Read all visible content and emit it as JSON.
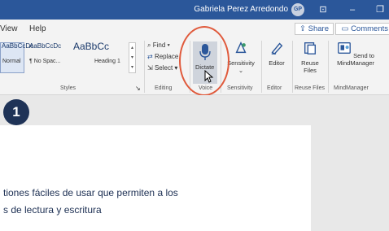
{
  "titlebar": {
    "user_name": "Gabriela Perez Arredondo",
    "user_initials": "GP",
    "controls": {
      "ribbon_display": "⊡",
      "minimize": "–",
      "restore": "❐"
    }
  },
  "menubar": {
    "tabs": [
      "View",
      "Help"
    ],
    "share_label": "Share",
    "comments_label": "Comments"
  },
  "ribbon": {
    "styles_group": {
      "label": "Styles",
      "items": [
        {
          "sample": "AaBbCcDc",
          "name": "Normal"
        },
        {
          "sample": "AaBbCcDc",
          "name": "¶ No Spac..."
        },
        {
          "sample": "AaBbCc",
          "name": "Heading 1"
        }
      ]
    },
    "editing_group": {
      "label": "Editing",
      "find": "Find",
      "replace": "Replace",
      "select": "Select"
    },
    "voice_group": {
      "label": "Voice",
      "dictate": "Dictate"
    },
    "sensitivity_group": {
      "label": "Sensitivity",
      "button": "Sensitivity"
    },
    "editor_group": {
      "label": "Editor",
      "button": "Editor"
    },
    "reuse_group": {
      "label": "Reuse Files",
      "button_line1": "Reuse",
      "button_line2": "Files"
    },
    "mindmanager_group": {
      "label": "MindManager",
      "button_line1": "Send to",
      "button_line2": "MindManager"
    }
  },
  "step_badge": "1",
  "document": {
    "line1": "tiones fáciles de usar que permiten a los",
    "line2": "s de lectura y escritura"
  },
  "colors": {
    "title_bar": "#2b579a",
    "highlight_circle": "#e05a3c",
    "badge": "#1f3357"
  }
}
